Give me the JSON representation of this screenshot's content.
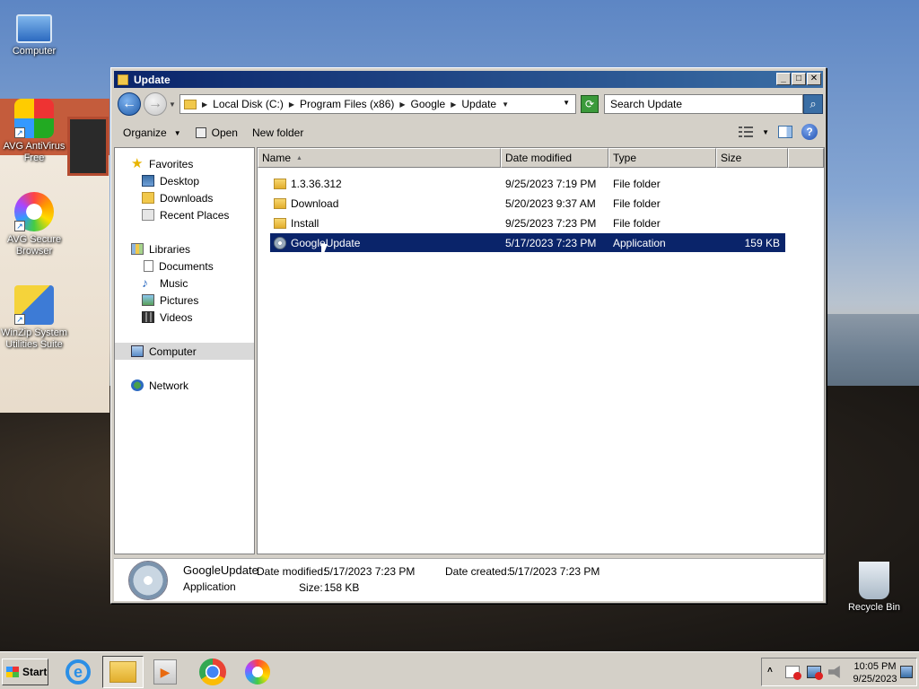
{
  "desktop": {
    "icons": [
      {
        "label": "Computer"
      },
      {
        "label": "AVG AntiVirus Free"
      },
      {
        "label": "AVG Secure Browser"
      },
      {
        "label": "WinZip System Utilities Suite"
      },
      {
        "label": "Recycle Bin"
      }
    ]
  },
  "window": {
    "title": "Update",
    "controls": {
      "minimize": "_",
      "maximize": "□",
      "close": "✕"
    }
  },
  "navbar": {
    "breadcrumbs": [
      "Local Disk (C:)",
      "Program Files (x86)",
      "Google",
      "Update"
    ],
    "search_placeholder": "Search Update"
  },
  "toolbar": {
    "organize": "Organize",
    "open": "Open",
    "new_folder": "New folder"
  },
  "navpane": {
    "favorites": "Favorites",
    "desktop": "Desktop",
    "downloads": "Downloads",
    "recent_places": "Recent Places",
    "libraries": "Libraries",
    "documents": "Documents",
    "music": "Music",
    "pictures": "Pictures",
    "videos": "Videos",
    "computer": "Computer",
    "network": "Network"
  },
  "filelist": {
    "columns": {
      "name": "Name",
      "date": "Date modified",
      "type": "Type",
      "size": "Size"
    },
    "rows": [
      {
        "name": "1.3.36.312",
        "date": "9/25/2023 7:19 PM",
        "type": "File folder",
        "size": "",
        "icon": "folder-icon"
      },
      {
        "name": "Download",
        "date": "5/20/2023 9:37 AM",
        "type": "File folder",
        "size": "",
        "icon": "folder-icon"
      },
      {
        "name": "Install",
        "date": "9/25/2023 7:23 PM",
        "type": "File folder",
        "size": "",
        "icon": "folder-icon"
      },
      {
        "name": "GoogleUpdate",
        "date": "5/17/2023 7:23 PM",
        "type": "Application",
        "size": "159 KB",
        "icon": "application-icon",
        "selected": true
      }
    ]
  },
  "details": {
    "name": "GoogleUpdate",
    "type": "Application",
    "date_modified_label": "Date modified:",
    "date_modified": "5/17/2023 7:23 PM",
    "date_created_label": "Date created:",
    "date_created": "5/17/2023 7:23 PM",
    "size_label": "Size:",
    "size": "158 KB"
  },
  "taskbar": {
    "start": "Start",
    "clock_time": "10:05 PM",
    "clock_date": "9/25/2023"
  },
  "colors": {
    "selection": "#0a246a",
    "title_gradient_start": "#0a246a",
    "title_gradient_end": "#3a6ea5",
    "chrome_face": "#d4d0c8"
  }
}
